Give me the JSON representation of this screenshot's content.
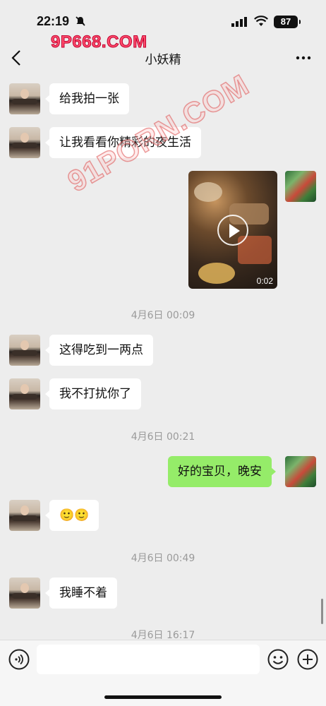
{
  "status_bar": {
    "time": "22:19",
    "battery": "87"
  },
  "watermarks": {
    "top": "9P668.COM",
    "diagonal": "91PORN.COM"
  },
  "nav": {
    "title": "小妖精"
  },
  "messages": [
    {
      "side": "left",
      "text": "给我拍一张"
    },
    {
      "side": "left",
      "text": "让我看看你精彩的夜生活"
    },
    {
      "side": "right",
      "type": "video",
      "duration": "0:02"
    },
    {
      "type": "timestamp",
      "text": "4月6日 00:09"
    },
    {
      "side": "left",
      "text": "这得吃到一两点"
    },
    {
      "side": "left",
      "text": "我不打扰你了"
    },
    {
      "type": "timestamp",
      "text": "4月6日 00:21"
    },
    {
      "side": "right",
      "text": "好的宝贝，晚安"
    },
    {
      "side": "left",
      "text": "🙂🙂"
    },
    {
      "type": "timestamp",
      "text": "4月6日 00:49"
    },
    {
      "side": "left",
      "text": "我睡不着"
    },
    {
      "type": "timestamp",
      "text": "4月6日 16:17"
    }
  ],
  "colors": {
    "background": "#ededed",
    "bubble_self": "#95ec69",
    "bubble_other": "#ffffff"
  }
}
